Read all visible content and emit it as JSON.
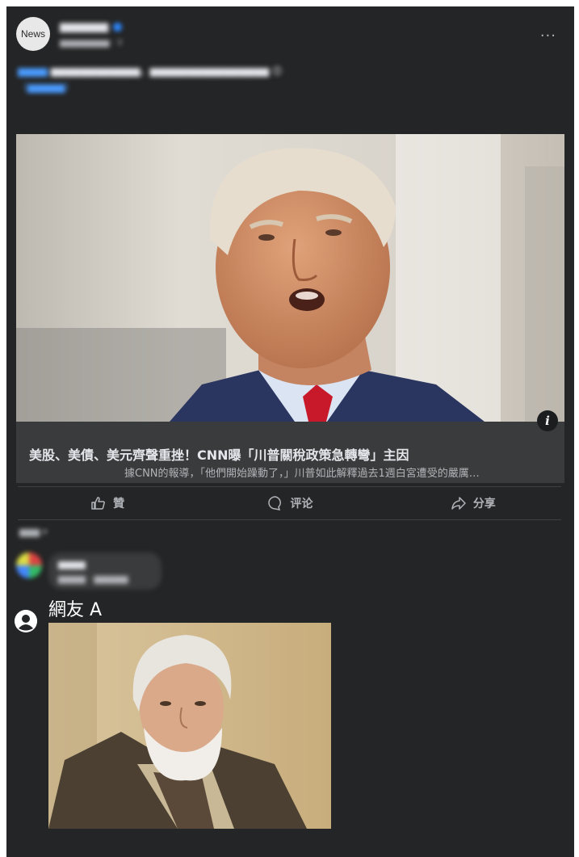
{
  "post": {
    "avatar_label": "News",
    "page_name": "▆▆▆▆▆▆",
    "time": "▆▆▆▆▆▆▆▆ · ⚲",
    "more": "···",
    "text_highlight": "▆▆▆▆",
    "text": "▆▆▆▆▆▆▆▆▆▆▆▆，▆▆▆▆▆▆▆▆▆▆▆▆▆▆▆▆ 😊",
    "see_more": "（▆▆▆▆▆）"
  },
  "link": {
    "title": "美股、美債、美元齊聲重挫！CNN曝「川普關稅政策急轉彎」主因",
    "description": "據CNN的報導，「他們開始躁動了，」川普如此解釋過去1週白宮遭受的嚴厲…",
    "info": "i"
  },
  "actions": [
    {
      "label": "贊",
      "icon": "like-icon"
    },
    {
      "label": "评论",
      "icon": "comment-icon"
    },
    {
      "label": "分享",
      "icon": "share-icon"
    }
  ],
  "comments": {
    "sort_label": "▆▆▆ ▾",
    "first": {
      "name": "▆▆▆▆",
      "text": "▆▆▆▆ · ▆▆▆▆▆"
    }
  },
  "reply": {
    "name": "網友 A",
    "icon": "person-icon"
  },
  "colors": {
    "card_bg": "#242526",
    "preview_bg": "#3a3b3c",
    "text_primary": "#e4e6eb",
    "text_secondary": "#b0b3b8",
    "accent_blue": "#2d88ff"
  }
}
